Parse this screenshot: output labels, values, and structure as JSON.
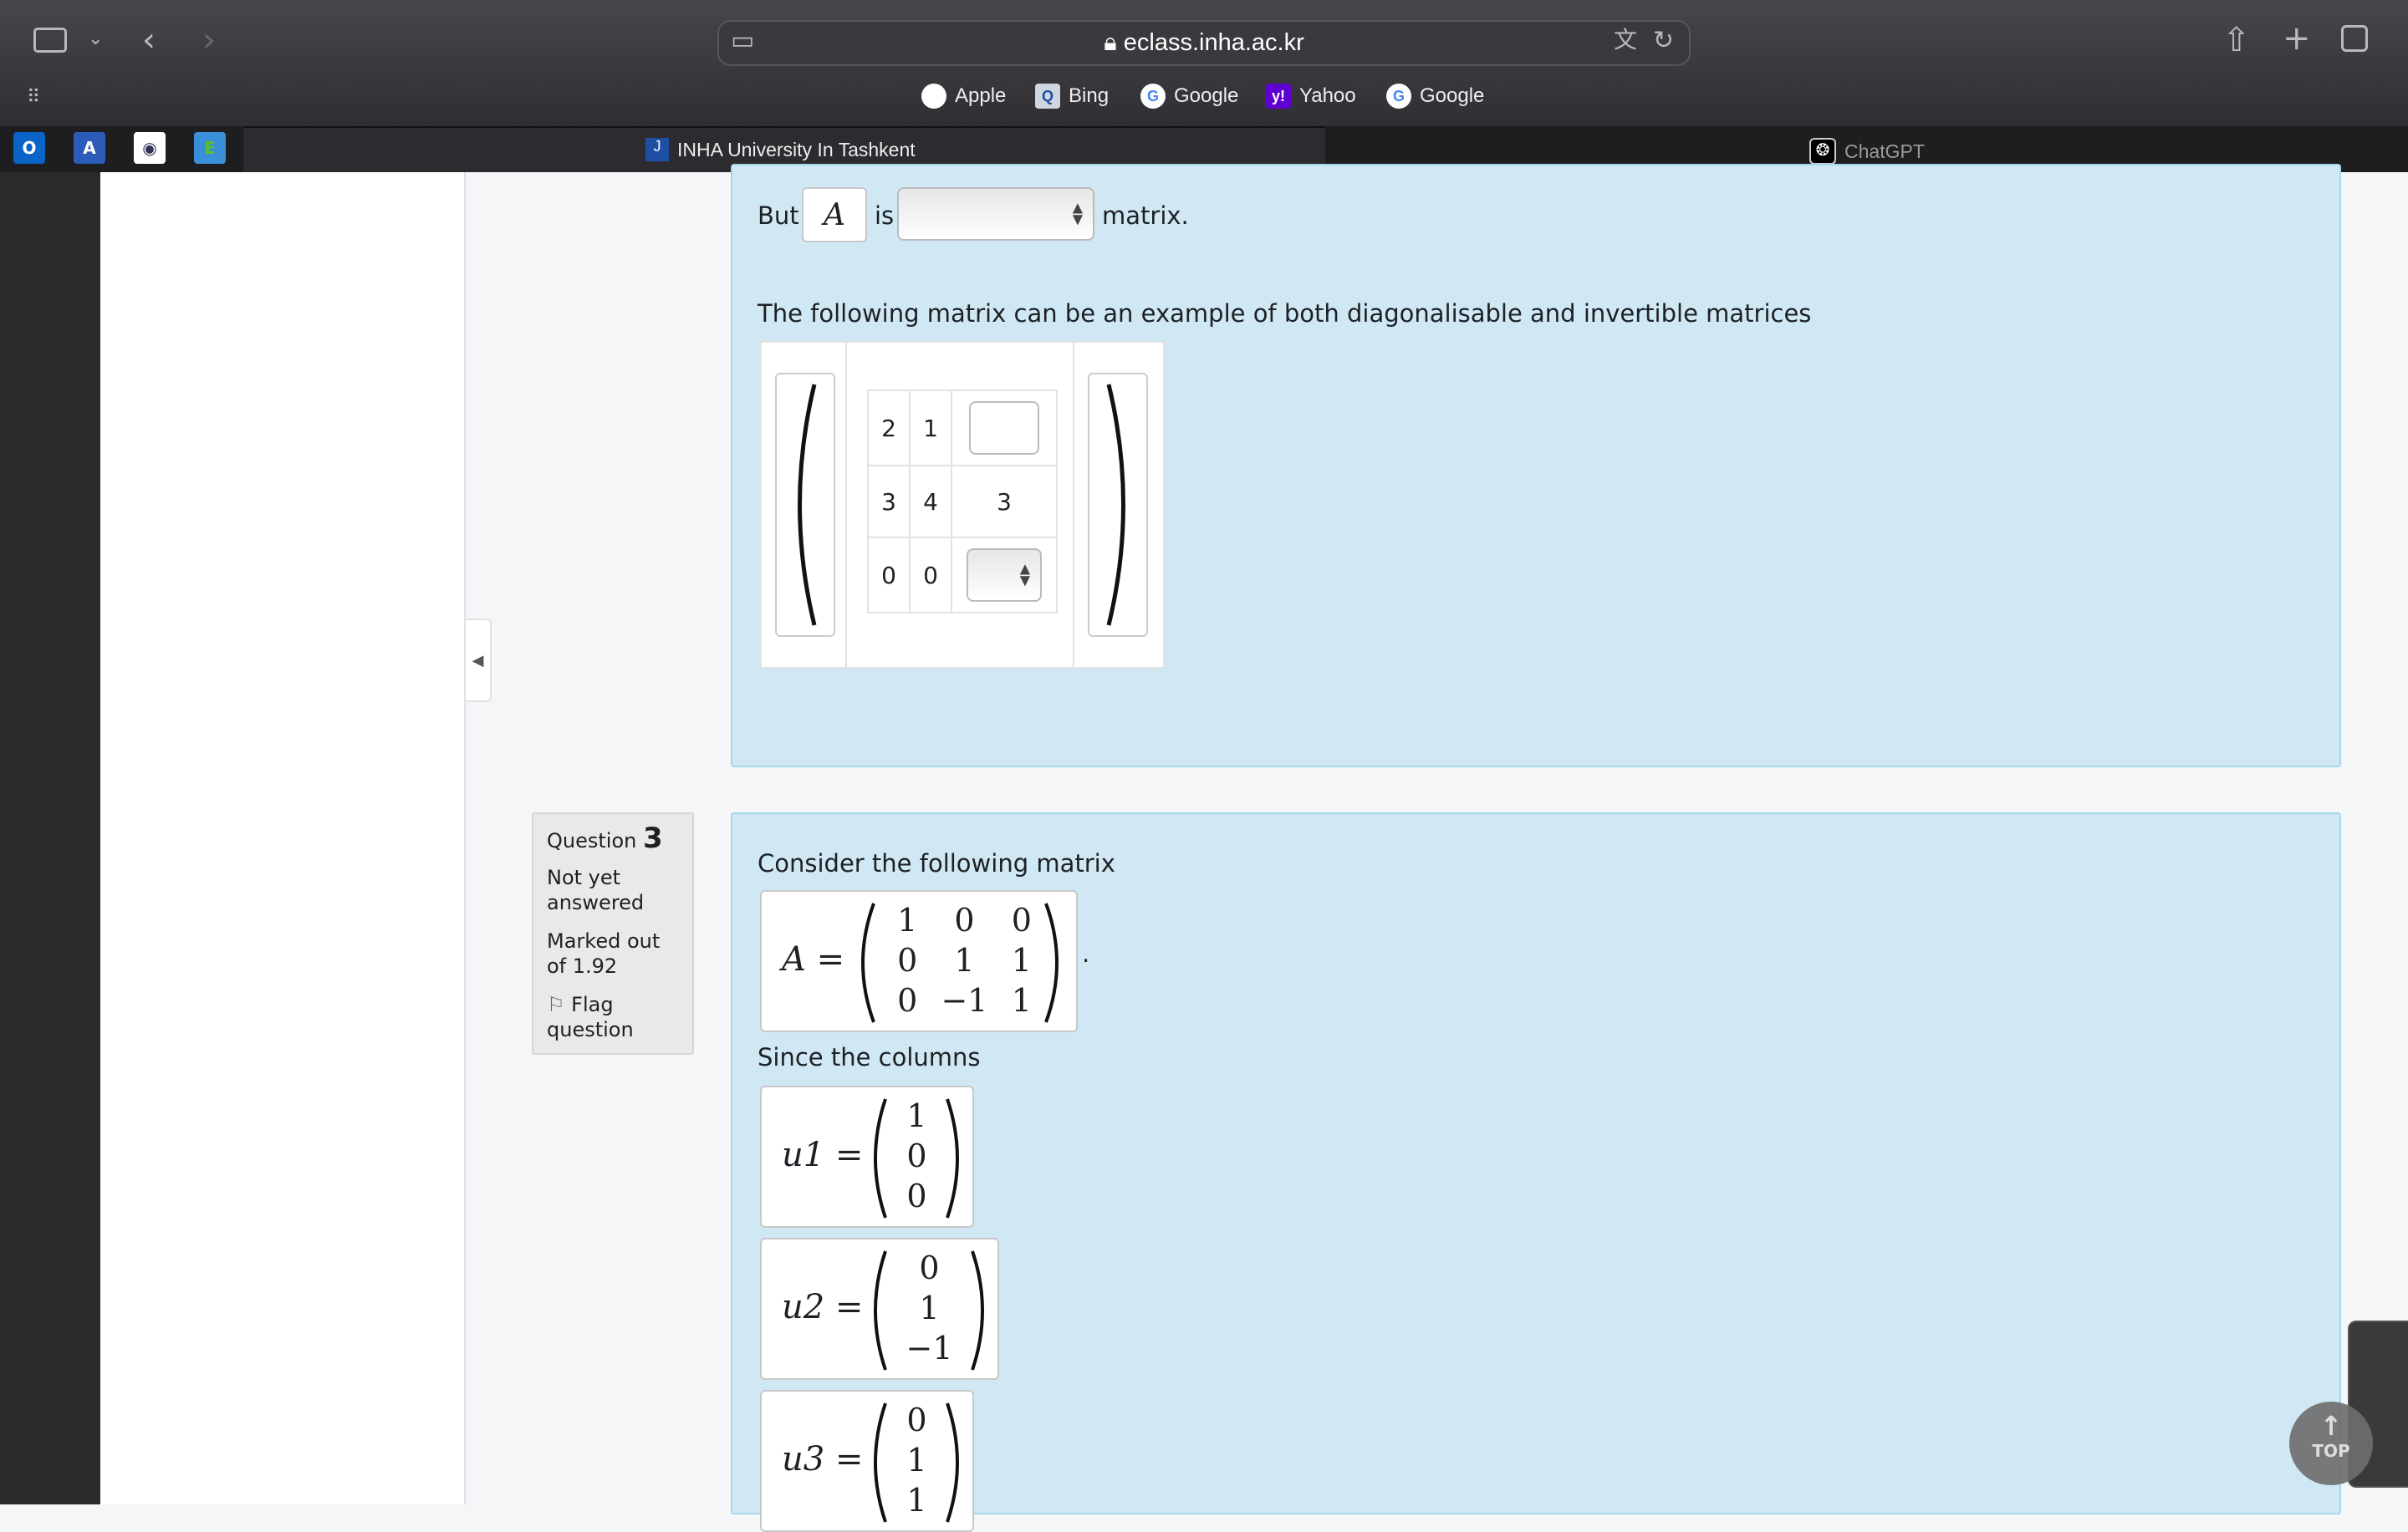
{
  "browser": {
    "url": "eclass.inha.ac.kr",
    "favorites": [
      {
        "label": "Apple",
        "icon": "apple-icon"
      },
      {
        "label": "Bing",
        "icon": "bing-icon"
      },
      {
        "label": "Google",
        "icon": "google-icon"
      },
      {
        "label": "Yahoo",
        "icon": "yahoo-icon"
      },
      {
        "label": "Google",
        "icon": "google-icon"
      }
    ],
    "tabs": [
      {
        "label": "INHA University In Tashkent",
        "active": true
      },
      {
        "label": "ChatGPT",
        "active": false
      }
    ]
  },
  "q2": {
    "but": "But",
    "var": "A",
    "is": "is",
    "matrix_suffix": "matrix.",
    "example_text": "The following matrix can be an example of both diagonalisable and invertible matrices",
    "grid": [
      [
        "2",
        "1",
        ""
      ],
      [
        "3",
        "4",
        "3"
      ],
      [
        "0",
        "0",
        ""
      ]
    ]
  },
  "q3": {
    "question_label": "Question",
    "number": "3",
    "status": "Not yet answered",
    "marked": "Marked out of 1.92",
    "flag": "Flag question",
    "intro": "Consider the following matrix",
    "matrix_lhs": "A =",
    "matrix": [
      [
        "1",
        "0",
        "0"
      ],
      [
        "0",
        "1",
        "1"
      ],
      [
        "0",
        "−1",
        "1"
      ]
    ],
    "since": "Since the columns",
    "columns": [
      {
        "name": "u1 =",
        "values": [
          "1",
          "0",
          "0"
        ]
      },
      {
        "name": "u2 =",
        "values": [
          "0",
          "1",
          "−1"
        ]
      },
      {
        "name": "u3 =",
        "values": [
          "0",
          "1",
          "1"
        ]
      }
    ]
  },
  "top_button": "TOP"
}
